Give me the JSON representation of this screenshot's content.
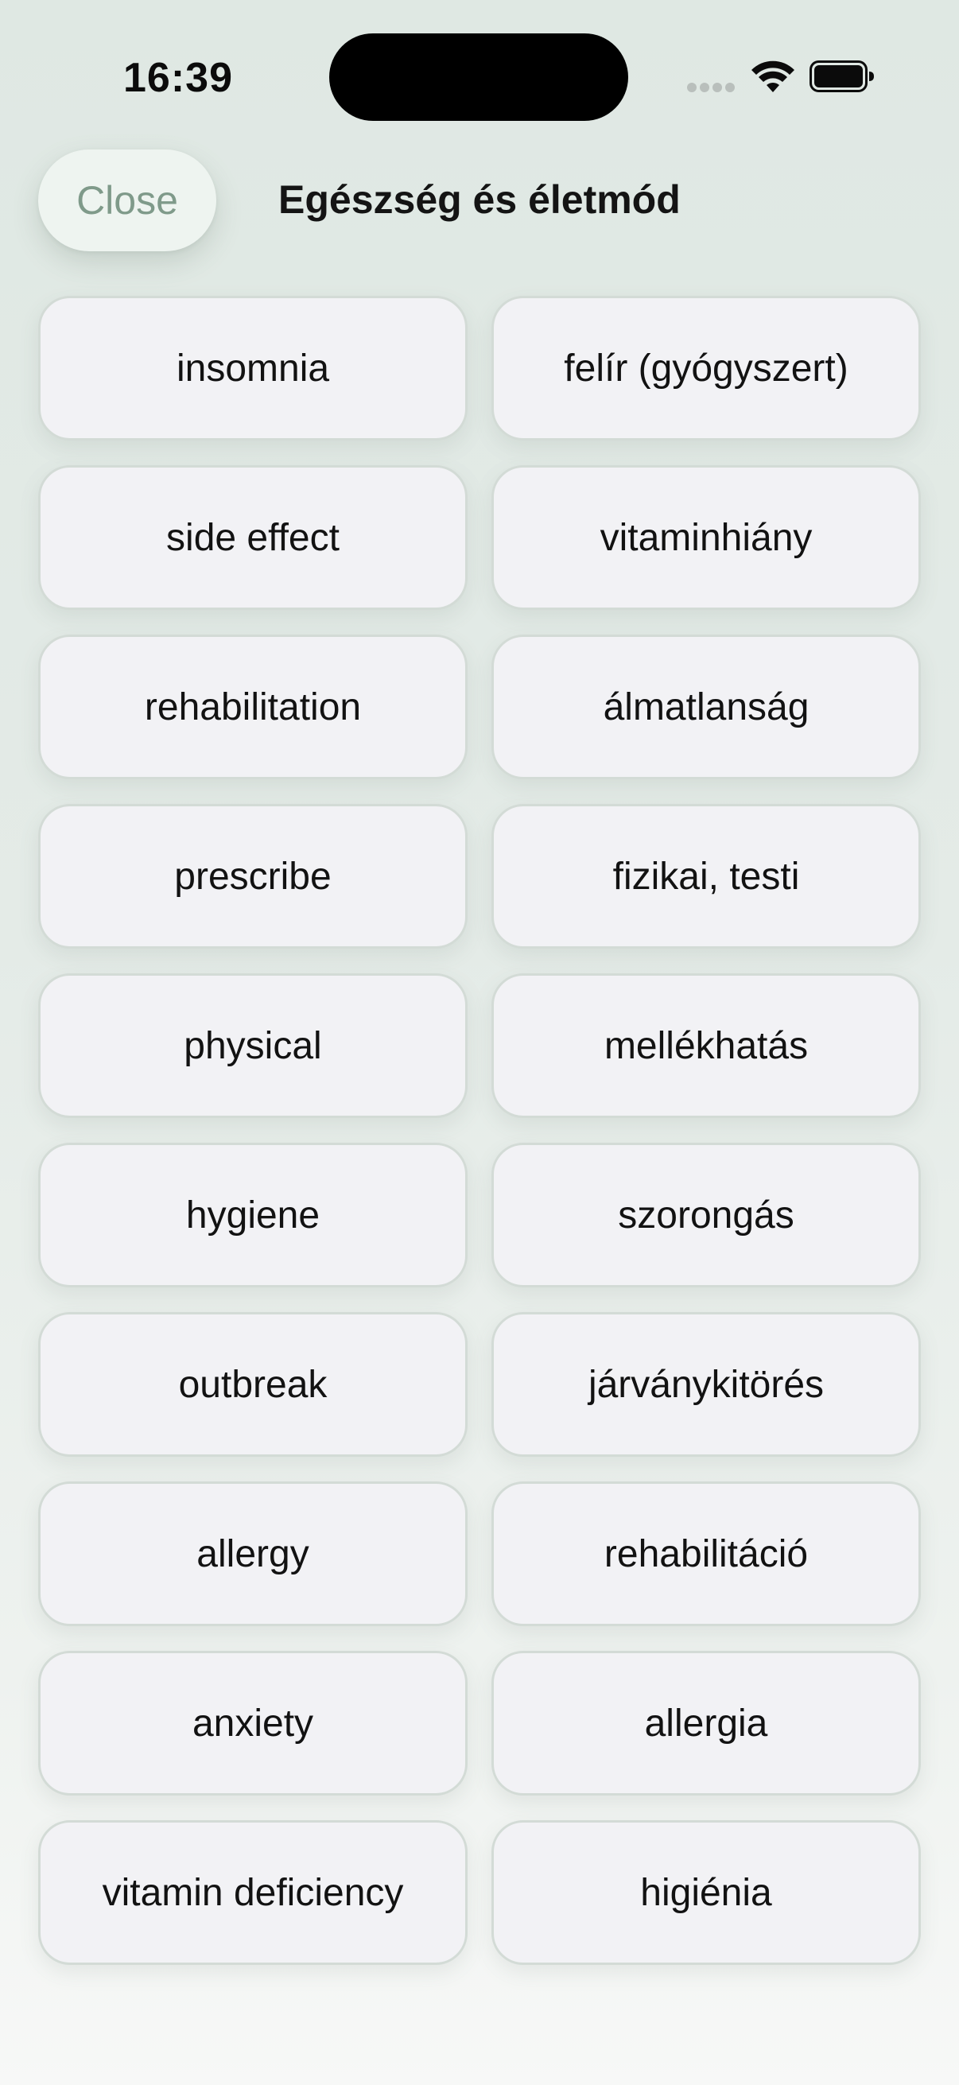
{
  "status_bar": {
    "time": "16:39"
  },
  "header": {
    "close_label": "Close",
    "title": "Egészség és életmód"
  },
  "colors": {
    "accent": "#7f9a8a",
    "background": "#e4ebe7",
    "tile_background": "#f2f2f5",
    "tile_border": "#d3dbd6"
  },
  "icons": {
    "signal": "signal-dots-icon",
    "wifi": "wifi-icon",
    "battery": "battery-icon"
  },
  "tiles": [
    {
      "label": "insomnia"
    },
    {
      "label": "felír (gyógyszert)"
    },
    {
      "label": "side effect"
    },
    {
      "label": "vitaminhiány"
    },
    {
      "label": "rehabilitation"
    },
    {
      "label": "álmatlanság"
    },
    {
      "label": "prescribe"
    },
    {
      "label": "fizikai, testi"
    },
    {
      "label": "physical"
    },
    {
      "label": "mellékhatás"
    },
    {
      "label": "hygiene"
    },
    {
      "label": "szorongás"
    },
    {
      "label": "outbreak"
    },
    {
      "label": "járványkitörés"
    },
    {
      "label": "allergy"
    },
    {
      "label": "rehabilitáció"
    },
    {
      "label": "anxiety"
    },
    {
      "label": "allergia"
    },
    {
      "label": "vitamin deficiency"
    },
    {
      "label": "higiénia"
    }
  ]
}
